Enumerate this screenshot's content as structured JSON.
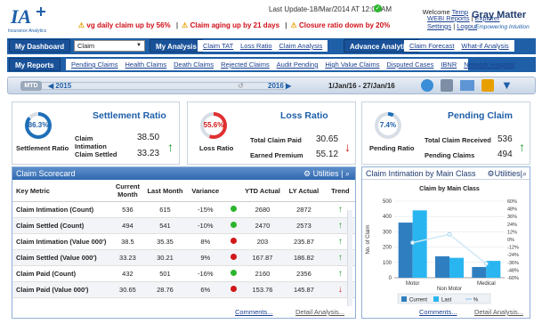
{
  "header": {
    "last_update": "Last Update-18/Mar/2014 AT 12:06 AM",
    "welcome": "Welcome",
    "user": "Temp",
    "links": [
      "WEBI Reports",
      "Explorer",
      "Settings",
      "Logout"
    ],
    "brand_tagline": "Insurance Analytics",
    "partner_name": "Gray Matter",
    "partner_tagline": "Empowering Intuition",
    "alerts": [
      "vg daily claim up by 56%",
      "Claim aging up by 21 days",
      "Closure ratio down by 20%"
    ]
  },
  "nav": {
    "dashboard_button": "My Dashboard",
    "dashboard_select": "Claim",
    "analysis_button": "My Analysis",
    "analysis_links": [
      "Claim TAT",
      "Loss Ratio",
      "Claim Analysis"
    ],
    "advance_button": "Advance Analytics",
    "advance_links": [
      "Claim Forecast",
      "What-if Analysis"
    ],
    "reports_button": "My Reports",
    "report_links": [
      "Pending Claims",
      "Health Claims",
      "Death Claims",
      "Rejected Claims",
      "Audit Pending",
      "High Value Claims",
      "Disputed Cases",
      "IBNR",
      "Network Hospital"
    ]
  },
  "timeline": {
    "mtd": "MTD",
    "start_year": "2015",
    "end_year": "2016",
    "range": "1/Jan/16 - 27/Jan/16"
  },
  "kpis": {
    "settlement": {
      "title": "Settlement Ratio",
      "gauge_value": "86.3%",
      "gauge_fraction": 0.863,
      "gauge_label": "Settlement Ratio",
      "row1_label": "Claim Intimation",
      "row1_value": "38.50",
      "row2_label": "Claim Settled",
      "row2_value": "33.23",
      "trend": "up"
    },
    "loss": {
      "title": "Loss Ratio",
      "gauge_value": "55.6%",
      "gauge_fraction": 0.556,
      "gauge_label": "Loss Ratio",
      "row1_label": "Total Claim Paid",
      "row1_value": "30.65",
      "row2_label": "Earned Premium",
      "row2_value": "55.12",
      "trend": "down"
    },
    "pending": {
      "title": "Pending Claim",
      "gauge_value": "7.4%",
      "gauge_fraction": 0.074,
      "gauge_label": "Pending Ratio",
      "row1_label": "Total Claim Received",
      "row1_value": "536",
      "row2_label": "Pending Claims",
      "row2_value": "494",
      "trend": "up"
    }
  },
  "scorecard": {
    "title": "Claim Scorecard",
    "utilities": "Utilities",
    "columns": [
      "Key Metric",
      "Current Month",
      "Last Month",
      "Variance",
      "",
      "YTD Actual",
      "LY Actual",
      "Trend"
    ],
    "rows": [
      {
        "metric": "Claim Intimation (Count)",
        "current": "536",
        "last": "615",
        "variance": "-15%",
        "status": "green",
        "ytd": "2680",
        "ly": "2872",
        "trend": "up"
      },
      {
        "metric": "Claim Settled (Count)",
        "current": "494",
        "last": "541",
        "variance": "-10%",
        "status": "green",
        "ytd": "2470",
        "ly": "2573",
        "trend": "up"
      },
      {
        "metric": "Claim Intimation (Value 000')",
        "current": "38.5",
        "last": "35.35",
        "variance": "8%",
        "status": "red",
        "ytd": "203",
        "ly": "235.87",
        "trend": "up"
      },
      {
        "metric": "Claim Settled (Value 000')",
        "current": "33.23",
        "last": "30.21",
        "variance": "9%",
        "status": "red",
        "ytd": "167.87",
        "ly": "186.82",
        "trend": "up"
      },
      {
        "metric": "Claim Paid (Count)",
        "current": "432",
        "last": "501",
        "variance": "-16%",
        "status": "green",
        "ytd": "2160",
        "ly": "2356",
        "trend": "up"
      },
      {
        "metric": "Claim Paid (Value 000')",
        "current": "30.65",
        "last": "28.76",
        "variance": "6%",
        "status": "red",
        "ytd": "153.76",
        "ly": "145.87",
        "trend": "down"
      }
    ],
    "footer_comments": "Comments...",
    "footer_detail": "Detail Analysis..."
  },
  "intimation_panel": {
    "title": "Claim Intimation by Main Class",
    "utilities": "Utilities",
    "footer_comments": "Comments...",
    "footer_detail": "Detail Analysis..."
  },
  "colors": {
    "accent": "#1e5fa8",
    "green": "#2db52d",
    "red": "#d01818",
    "current": "#2f7fc0",
    "last": "#29b6f0"
  },
  "chart_data": {
    "type": "bar",
    "title": "Claim by Main Class",
    "categories": [
      "Motor",
      "Non Motor",
      "Medical"
    ],
    "series": [
      {
        "name": "Current",
        "type": "bar",
        "values": [
          360,
          140,
          70
        ]
      },
      {
        "name": "Last",
        "type": "bar",
        "values": [
          440,
          130,
          110
        ]
      },
      {
        "name": "%",
        "type": "line",
        "axis": "right",
        "values": [
          -5,
          8,
          -38
        ]
      }
    ],
    "ylabel": "No. of Claim",
    "ylim": [
      0,
      500
    ],
    "y2lim": [
      -60,
      60
    ],
    "yticks": [
      "0",
      "100",
      "200",
      "300",
      "400",
      "500"
    ],
    "y2ticks": [
      "-60%",
      "-48%",
      "-36%",
      "-24%",
      "-12%",
      "0%",
      "12%",
      "24%",
      "36%",
      "48%",
      "60%"
    ],
    "legend": "bottom",
    "grid": true
  }
}
